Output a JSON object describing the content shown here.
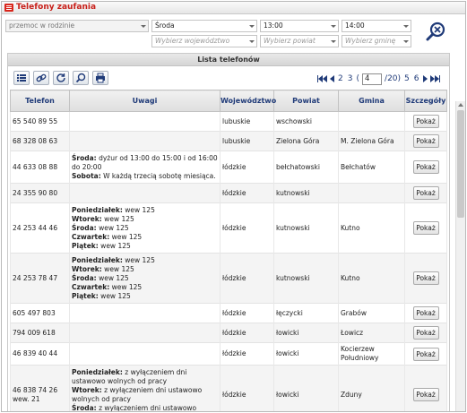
{
  "window": {
    "title": "Telefony zaufania"
  },
  "filters": {
    "category": "przemoc w rodzinie",
    "day": "Środa",
    "time_from": "13:00",
    "time_to": "14:00",
    "voivodeship_placeholder": "Wybierz województwo",
    "county_placeholder": "Wybierz powiat",
    "commune_placeholder": "Wybierz gminę"
  },
  "panel": {
    "title": "Lista telefonów"
  },
  "pager": {
    "pages_before": [
      "2",
      "3"
    ],
    "current": "4",
    "total": "/20)",
    "open_paren": "(",
    "pages_after": [
      "5",
      "6"
    ]
  },
  "columns": [
    "Telefon",
    "Uwagi",
    "Województwo",
    "Powiat",
    "Gmina",
    "Szczegóły"
  ],
  "button_label": "Pokaż",
  "rows": [
    {
      "phone": "65 540 89 55",
      "notes": [],
      "voivodeship": "lubuskie",
      "county": "wschowski",
      "commune": ""
    },
    {
      "phone": "68 328 08 63",
      "notes": [],
      "voivodeship": "lubuskie",
      "county": "Zielona Góra",
      "commune": "M. Zielona Góra"
    },
    {
      "phone": "44 633 08 88",
      "notes": [
        {
          "label": "Środa:",
          "text": " dyżur od 13:00 do 15:00 i od 16:00 do 20:00"
        },
        {
          "label": "Sobota:",
          "text": " W każdą trzecią sobotę miesiąca."
        }
      ],
      "voivodeship": "łódzkie",
      "county": "bełchatowski",
      "commune": "Bełchatów"
    },
    {
      "phone": "24 355 90 80",
      "notes": [],
      "voivodeship": "łódzkie",
      "county": "kutnowski",
      "commune": ""
    },
    {
      "phone": "24 253 44 46",
      "notes": [
        {
          "label": "Poniedziałek:",
          "text": " wew 125"
        },
        {
          "label": "Wtorek:",
          "text": " wew 125"
        },
        {
          "label": "Środa:",
          "text": " wew 125"
        },
        {
          "label": "Czwartek:",
          "text": " wew 125"
        },
        {
          "label": "Piątek:",
          "text": " wew 125"
        }
      ],
      "voivodeship": "łódzkie",
      "county": "kutnowski",
      "commune": "Kutno"
    },
    {
      "phone": "24 253 78 47",
      "notes": [
        {
          "label": "Poniedziałek:",
          "text": " wew 125"
        },
        {
          "label": "Wtorek:",
          "text": " wew 125"
        },
        {
          "label": "Środa:",
          "text": " wew 125"
        },
        {
          "label": "Czwartek:",
          "text": " wew 125"
        },
        {
          "label": "Piątek:",
          "text": " wew 125"
        }
      ],
      "voivodeship": "łódzkie",
      "county": "kutnowski",
      "commune": "Kutno"
    },
    {
      "phone": "605 497 803",
      "notes": [],
      "voivodeship": "łódzkie",
      "county": "łęczycki",
      "commune": "Grabów"
    },
    {
      "phone": "794 009 618",
      "notes": [],
      "voivodeship": "łódzkie",
      "county": "łowicki",
      "commune": "Łowicz"
    },
    {
      "phone": "46 839 40 44",
      "notes": [],
      "voivodeship": "łódzkie",
      "county": "łowicki",
      "commune": "Kocierzew Południowy"
    },
    {
      "phone": "46 838 74 26 wew. 21",
      "notes": [
        {
          "label": "Poniedziałek:",
          "text": " z wyłączeniem dni ustawowo wolnych od pracy"
        },
        {
          "label": "Wtorek:",
          "text": " z wyłączeniem dni ustawowo wolnych od pracy"
        },
        {
          "label": "Środa:",
          "text": " z wyłączeniem dni ustawowo wolnych od pracy"
        }
      ],
      "voivodeship": "łódzkie",
      "county": "łowicki",
      "commune": "Zduny"
    }
  ]
}
